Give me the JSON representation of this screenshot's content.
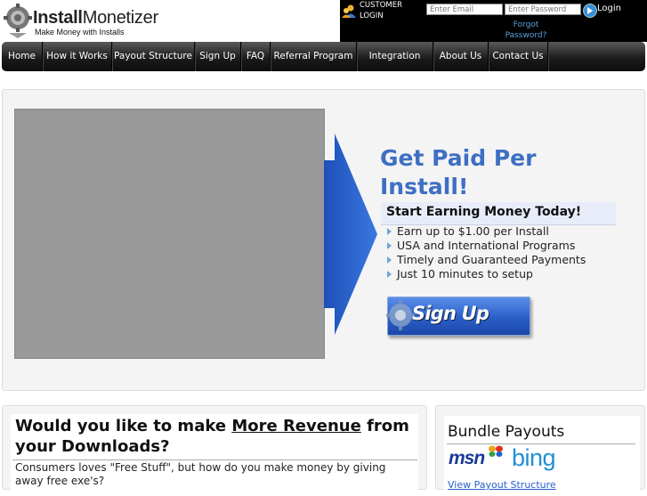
{
  "brand": {
    "name_part1": "Install",
    "name_part2": "Monetizer",
    "tagline": "Make Money with Installs"
  },
  "login": {
    "label_line1": "CUSTOMER",
    "label_line2": "LOGIN",
    "email_placeholder": "Enter Email",
    "password_placeholder": "Enter Password",
    "login_label": "Login",
    "forgot_line1": "Forgot",
    "forgot_line2": "Password?"
  },
  "nav": {
    "items": [
      {
        "label": "Home"
      },
      {
        "label": "How it Works"
      },
      {
        "label": "Payout Structure"
      },
      {
        "label": "Sign Up"
      },
      {
        "label": "FAQ"
      },
      {
        "label": "Referral Program"
      },
      {
        "label": "Integration Help"
      },
      {
        "label": "About Us"
      },
      {
        "label": "Contact Us"
      }
    ]
  },
  "hero": {
    "title": "Get Paid Per Install!",
    "subtitle": "Start Earning Money Today!",
    "bullets": [
      "Earn up to $1.00 per Install",
      "USA and International Programs",
      "Timely and Guaranteed Payments",
      "Just 10 minutes to setup"
    ],
    "signup_label": "Sign Up"
  },
  "revenue": {
    "title_a": "Would you like to make ",
    "title_link": "More Revenue",
    "title_b": " from your Downloads?",
    "body": "Consumers loves \"Free Stuff\", but how do you make money by giving away free exe's?"
  },
  "bundle": {
    "title": "Bundle Payouts",
    "logo1": "msn",
    "logo2": "bing",
    "view_link": "View Payout Structure"
  },
  "colors": {
    "accent": "#3e6fc4",
    "nav_bg": "#1c1c1c",
    "bing": "#1f8fd6"
  }
}
